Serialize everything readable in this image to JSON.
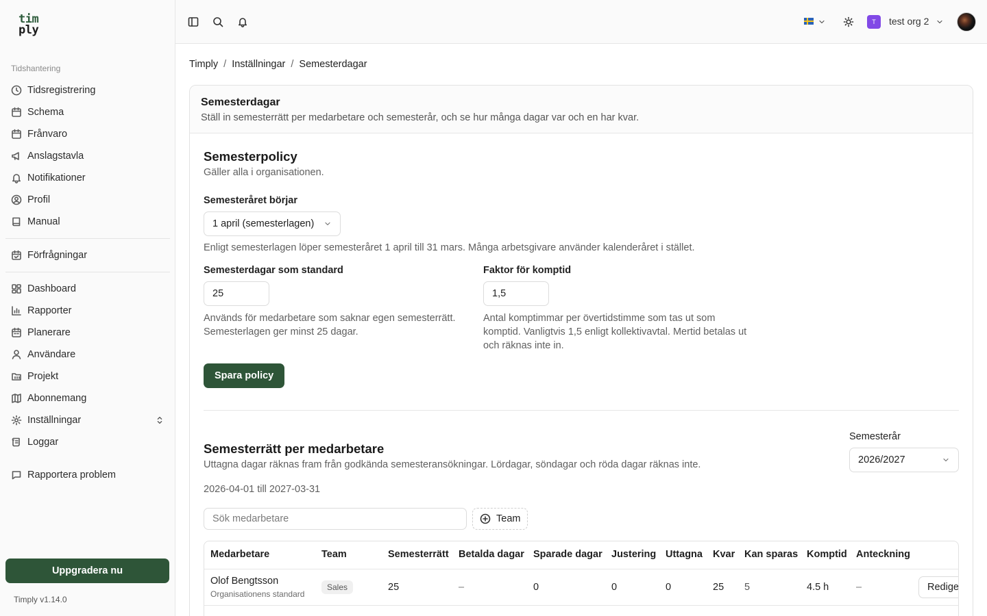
{
  "logo": {
    "line1": "tim",
    "line2": "ply"
  },
  "sidebar": {
    "section_label": "Tidshantering",
    "items": [
      {
        "label": "Tidsregistrering",
        "icon": "clock-icon"
      },
      {
        "label": "Schema",
        "icon": "calendar-icon"
      },
      {
        "label": "Frånvaro",
        "icon": "calendar-icon"
      },
      {
        "label": "Anslagstavla",
        "icon": "megaphone-icon"
      },
      {
        "label": "Notifikationer",
        "icon": "bell-icon"
      },
      {
        "label": "Profil",
        "icon": "user-circle-icon"
      },
      {
        "label": "Manual",
        "icon": "book-icon"
      },
      {
        "label": "Förfrågningar",
        "icon": "calendar-check-icon"
      },
      {
        "label": "Dashboard",
        "icon": "dashboard-icon"
      },
      {
        "label": "Rapporter",
        "icon": "bar-chart-icon"
      },
      {
        "label": "Planerare",
        "icon": "calendar-icon"
      },
      {
        "label": "Användare",
        "icon": "user-icon"
      },
      {
        "label": "Projekt",
        "icon": "folder-icon"
      },
      {
        "label": "Abonnemang",
        "icon": "map-icon"
      },
      {
        "label": "Inställningar",
        "icon": "gear-icon"
      },
      {
        "label": "Loggar",
        "icon": "scroll-icon"
      },
      {
        "label": "Rapportera problem",
        "icon": "message-icon"
      }
    ],
    "upgrade_label": "Uppgradera nu",
    "version": "Timply v1.14.0"
  },
  "topbar": {
    "org_initial": "T",
    "org_name": "test org 2",
    "language": "sv"
  },
  "breadcrumb": [
    "Timply",
    "Inställningar",
    "Semesterdagar"
  ],
  "page": {
    "title": "Semesterdagar",
    "subtitle": "Ställ in semesterrätt per medarbetare och semesterår, och se hur många dagar var och en har kvar."
  },
  "policy": {
    "title": "Semesterpolicy",
    "subtitle": "Gäller alla i organisationen.",
    "year_start_label": "Semesteråret börjar",
    "year_start_value": "1 april (semesterlagen)",
    "year_start_help": "Enligt semesterlagen löper semesteråret 1 april till 31 mars. Många arbetsgivare använder kalenderåret i stället.",
    "default_days_label": "Semesterdagar som standard",
    "default_days_value": "25",
    "default_days_help": "Används för medarbetare som saknar egen semesterrätt. Semesterlagen ger minst 25 dagar.",
    "comp_factor_label": "Faktor för komptid",
    "comp_factor_value": "1,5",
    "comp_factor_help": "Antal komptimmar per övertidstimme som tas ut som komptid. Vanligtvis 1,5 enligt kollektivavtal. Mertid betalas ut och räknas inte in.",
    "save_label": "Spara policy"
  },
  "entitlements": {
    "title": "Semesterrätt per medarbetare",
    "subtitle": "Uttagna dagar räknas fram från godkända semesteransökningar. Lördagar, söndagar och röda dagar räknas inte.",
    "range": "2026-04-01 till 2027-03-31",
    "year_label": "Semesterår",
    "year_value": "2026/2027",
    "search_placeholder": "Sök medarbetare",
    "team_filter_label": "Team",
    "columns": [
      "Medarbetare",
      "Team",
      "Semesterrätt",
      "Betalda dagar",
      "Sparade dagar",
      "Justering",
      "Uttagna",
      "Kvar",
      "Kan sparas",
      "Komptid",
      "Anteckning"
    ],
    "rows": [
      {
        "name": "Olof Bengtsson",
        "source": "Organisationens standard",
        "team": "Sales",
        "entitlement": "25",
        "paid": "–",
        "saved": "0",
        "adjustment": "0",
        "taken": "0",
        "remaining": "25",
        "can_save": "5",
        "comp": "4.5 h",
        "note": "–",
        "edit_label": "Redigera"
      }
    ]
  }
}
